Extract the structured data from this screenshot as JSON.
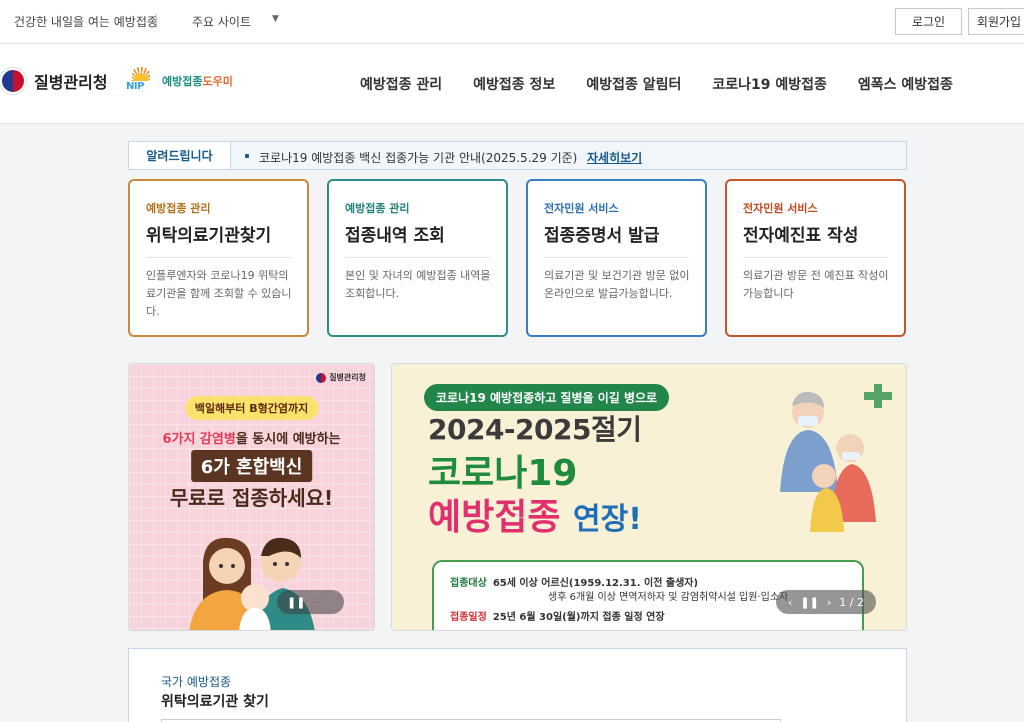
{
  "topbar": {
    "slogan": "건강한 내일을 여는 예방접종",
    "sites_label": "주요 사이트",
    "login": "로그인",
    "signup": "회원가입"
  },
  "header": {
    "kdca_name": "질병관리청",
    "nip_abbr": "NIP",
    "nip_name_a": "예방접종",
    "nip_name_b": "도우미",
    "nav": [
      "예방접종 관리",
      "예방접종 정보",
      "예방접종 알림터",
      "코로나19 예방접종",
      "엠폭스 예방접종"
    ]
  },
  "notice": {
    "tag": "알려드립니다",
    "text": "코로나19 예방접종 백신 접종가능 기관 안내(2025.5.29 기준)",
    "more": "자세히보기"
  },
  "cards": [
    {
      "category": "예방접종 관리",
      "title": "위탁의료기관찾기",
      "desc": "인플루엔자와 코로나19 위탁의료기관을 함께 조회할 수 있습니다."
    },
    {
      "category": "예방접종 관리",
      "title": "접종내역 조회",
      "desc": "본인 및 자녀의 예방접종 내역을 조회합니다."
    },
    {
      "category": "전자민원 서비스",
      "title": "접종증명서 발급",
      "desc": "의료기관 및 보건기관 방문 없이 온라인으로 발급가능합니다."
    },
    {
      "category": "전자민원 서비스",
      "title": "전자예진표 작성",
      "desc": "의료기관 방문 전 예진표 작성이 가능합니다"
    }
  ],
  "banner_left": {
    "logo": "질병관리청",
    "pill": "백일해부터 B형간염까지",
    "line1_a": "6가지 감염병",
    "line1_b": "을 동시에 예방하는",
    "line2": "6가 혼합백신",
    "line3": "무료로 접종하세요!"
  },
  "banner_right": {
    "pill": "코로나19 예방접종하고 질병을 이길 병으로",
    "year": "2024-2025절기",
    "covid": "코로나19",
    "vax_a": "예방접종",
    "vax_b": "연장!",
    "target_label": "접종대상",
    "target_text": "65세 이상 어르신(1959.12.31. 이전 출생자)",
    "target_text2": "생후 6개월 이상 면역저하자 및 감염취약시설 입원·입소자",
    "period_label": "접종일정",
    "period_text": "25년 6월 30일(월)까지 접종 일정 연장",
    "pager": "1 / 2"
  },
  "search": {
    "sub": "국가 예방접종",
    "title": "위탁의료기관 찾기"
  }
}
